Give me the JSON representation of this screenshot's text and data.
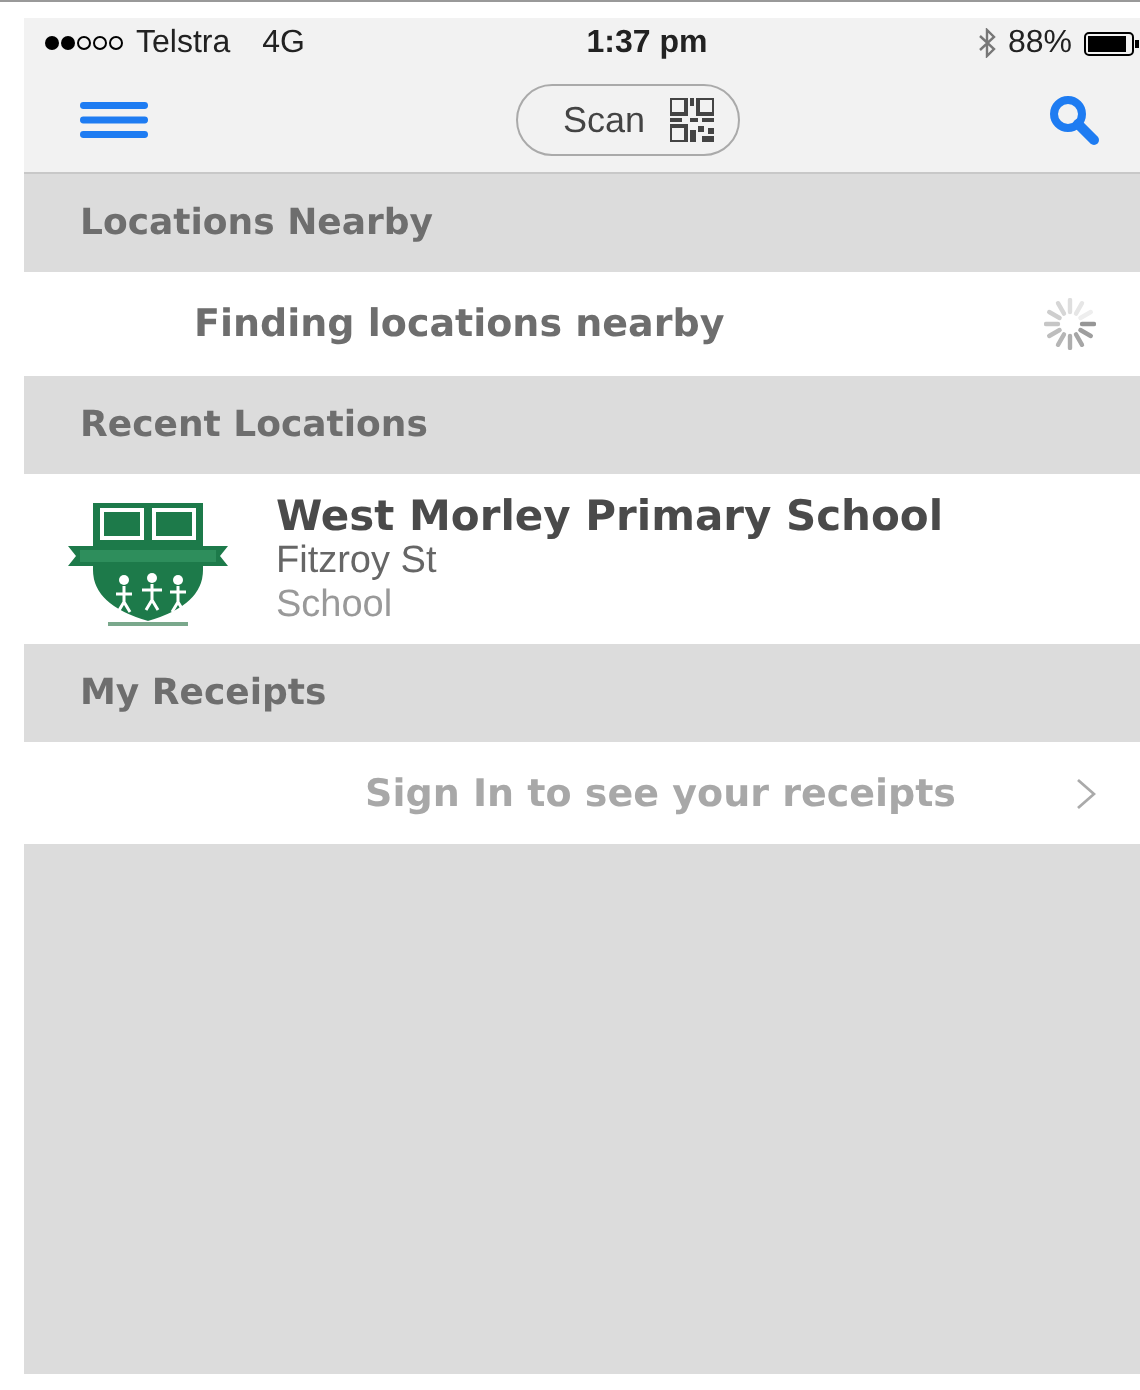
{
  "status_bar": {
    "carrier": "Telstra",
    "network": "4G",
    "time": "1:37 pm",
    "battery": "88%"
  },
  "nav_bar": {
    "scan_button": "Scan"
  },
  "sections": [
    {
      "title": "Locations Nearby",
      "rows": [
        {
          "kind": "loading",
          "text": "Finding locations nearby"
        }
      ]
    },
    {
      "title": "Recent Locations",
      "rows": [
        {
          "kind": "location",
          "name": "West Morley Primary School",
          "street": "Fitzroy St",
          "category": "School"
        }
      ]
    },
    {
      "title": "My Receipts",
      "rows": [
        {
          "kind": "link",
          "text": "Sign In to see your receipts"
        }
      ]
    }
  ]
}
